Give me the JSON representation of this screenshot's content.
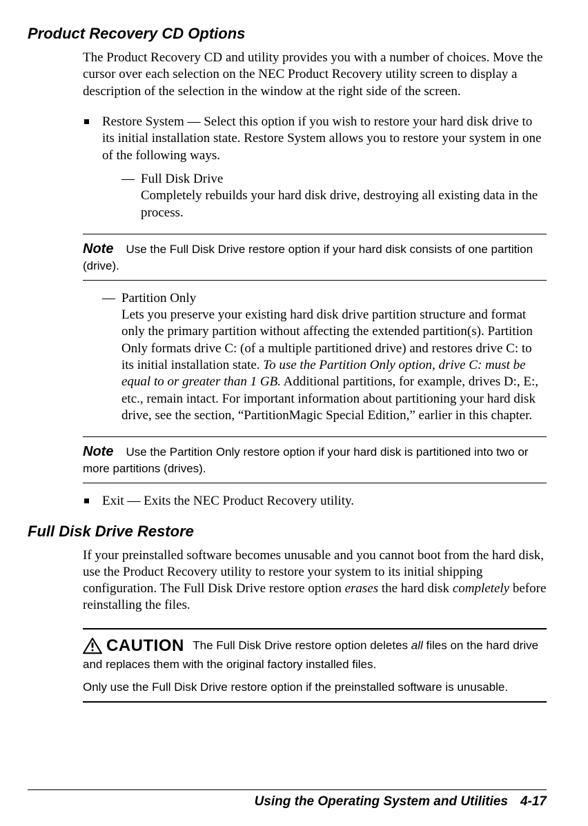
{
  "heading1": "Product Recovery CD Options",
  "intro": "The Product Recovery CD and utility provides you with a number of choices. Move the cursor over each selection on the NEC Product Recovery utility screen to display a description of the selection in the window at the right side of the screen.",
  "restore_intro": "Restore System — Select this option if you wish to restore your hard disk drive to its initial installation state. Restore System allows you to restore your system in one of the following ways.",
  "full_disk_title": "Full Disk Drive",
  "full_disk_body": "Completely rebuilds your hard disk drive, destroying all existing data in the process.",
  "note1_label": "Note",
  "note1_text": "Use the Full Disk Drive restore option if your hard disk consists of one partition (drive).",
  "partition_title": "Partition Only",
  "partition_body_pre": "Lets you preserve your existing hard disk drive partition structure and format only the primary partition without affecting the extended partition(s). Partition Only formats drive C: (of a multiple partitioned drive) and restores drive C: to its initial installation state. ",
  "partition_body_ital": "To use the Partition Only option, drive C: must be equal to or greater than 1 GB.",
  "partition_body_post": " Additional partitions, for example, drives D:, E:, etc., remain intact. For important information about partitioning your hard disk drive, see the section, “PartitionMagic Special Edition,” earlier in this chapter.",
  "note2_label": "Note",
  "note2_text": "Use the Partition Only restore option if your hard disk is partitioned into two or more partitions (drives).",
  "exit_text": "Exit — Exits the NEC Product Recovery utility.",
  "heading2": "Full Disk Drive Restore",
  "fdr_para_pre": "If your preinstalled software becomes unusable and you cannot boot from the hard disk, use the Product Recovery utility to restore your system to its initial shipping configuration. The Full Disk Drive restore option ",
  "fdr_para_ital1": "erases",
  "fdr_para_mid": " the hard disk ",
  "fdr_para_ital2": "completely",
  "fdr_para_post": " before reinstalling the files.",
  "caution_word": "CAUTION",
  "caution_text_pre": "The Full Disk Drive restore option deletes ",
  "caution_text_ital": "all",
  "caution_text_post": " files on the hard drive and replaces them with the original factory installed files.",
  "caution_para2": "Only use the Full Disk Drive restore option if the preinstalled software is unusable.",
  "footer_title": "Using the Operating System and Utilities",
  "footer_page": "4-17"
}
